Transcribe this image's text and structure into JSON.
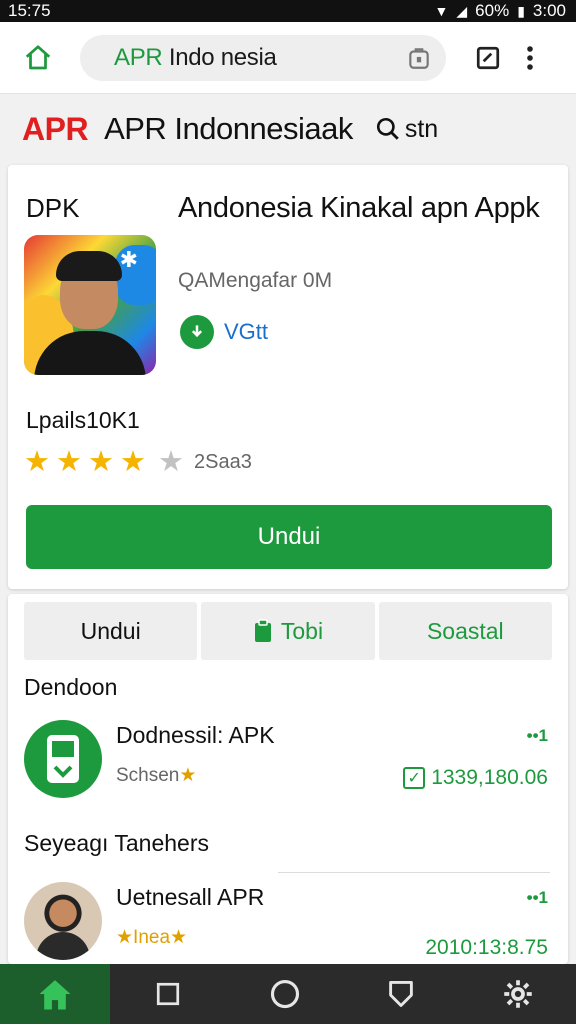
{
  "status_bar": {
    "time": "15:75",
    "battery": "60%",
    "clock": "3:00"
  },
  "browser": {
    "url_prefix": "APR",
    "url_rest": " Indo nesia"
  },
  "site": {
    "logo": "APR",
    "title": "APR Indonnesiaak",
    "search_label": "stn"
  },
  "app": {
    "label": "DPK",
    "title": "Andonesia Kinakal apn Appk",
    "subtitle": "QAMengafar 0M",
    "verified_label": "VGtt",
    "downloads": "Lpails10K1",
    "rating_count": "2Saa3",
    "rating_stars": 4,
    "download_button": "Undui"
  },
  "tabs": [
    {
      "label": "Undui"
    },
    {
      "label": "Tobi"
    },
    {
      "label": "Soastal"
    }
  ],
  "sections": [
    {
      "heading": "Dendoon",
      "item": {
        "name": "Dodnessil: APK",
        "sub": "Schsen",
        "dots": "••1",
        "version": "1339,180.06"
      }
    },
    {
      "heading": "Seyeagı Tanehers",
      "item": {
        "name": "Uetnesall APR",
        "sub": "Inea",
        "dots": "••1",
        "version": "2010:13:8.75"
      }
    }
  ],
  "colors": {
    "accent": "#1e9a3e",
    "logo_red": "#e02020",
    "star": "#f4b400",
    "link_blue": "#1a6fcc"
  }
}
